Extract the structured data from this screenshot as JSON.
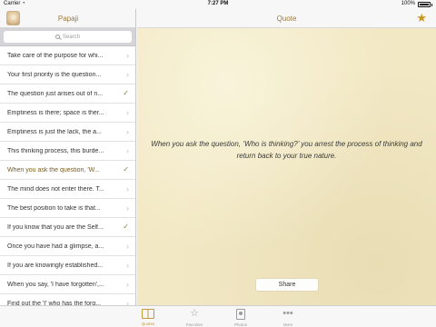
{
  "status_bar": {
    "carrier": "Carrier",
    "wifi_icon": "wifi-icon",
    "time": "7:27 PM",
    "battery": "100%"
  },
  "sidebar": {
    "title": "Papaji",
    "avatar_icon": "avatar",
    "search_placeholder": "Search",
    "quotes": [
      {
        "text": "Take care of the purpose for whi...",
        "mark": "chevron"
      },
      {
        "text": "Your first priority is the question...",
        "mark": "chevron"
      },
      {
        "text": "The question just arises out of n...",
        "mark": "check"
      },
      {
        "text": "Emptiness is there; space is ther...",
        "mark": "chevron"
      },
      {
        "text": "Emptiness is just the lack, the a...",
        "mark": "chevron"
      },
      {
        "text": "This thinking process, this burde...",
        "mark": "chevron"
      },
      {
        "text": "When you ask the question, 'W...",
        "mark": "check"
      },
      {
        "text": "The mind does not enter there. T...",
        "mark": "chevron"
      },
      {
        "text": "The best position to take is that...",
        "mark": "chevron"
      },
      {
        "text": "If you know that you are the Self...",
        "mark": "check"
      },
      {
        "text": "Once you have had a glimpse, a...",
        "mark": "chevron"
      },
      {
        "text": "If you are knowingly established...",
        "mark": "chevron"
      },
      {
        "text": "When you say, 'I have forgotten',...",
        "mark": "chevron"
      },
      {
        "text": "Find out the 'I' who has the forg...",
        "mark": "chevron"
      }
    ]
  },
  "detail": {
    "nav_title": "Quote",
    "favorite_icon": "star-icon",
    "quote": "When you ask the question, ‘Who is thinking?’ you arrest the process of thinking and return back to your true nature.",
    "share_label": "Share"
  },
  "tabs": [
    {
      "label": "Quotes",
      "icon": "book-icon",
      "active": true
    },
    {
      "label": "Favorites",
      "icon": "star-outline-icon",
      "active": false
    },
    {
      "label": "Photos",
      "icon": "photo-icon",
      "active": false
    },
    {
      "label": "More",
      "icon": "more-icon",
      "active": false
    }
  ],
  "colors": {
    "accent": "#c59a3a",
    "title": "#9a7b40",
    "parchment": "#f2e8c4"
  }
}
